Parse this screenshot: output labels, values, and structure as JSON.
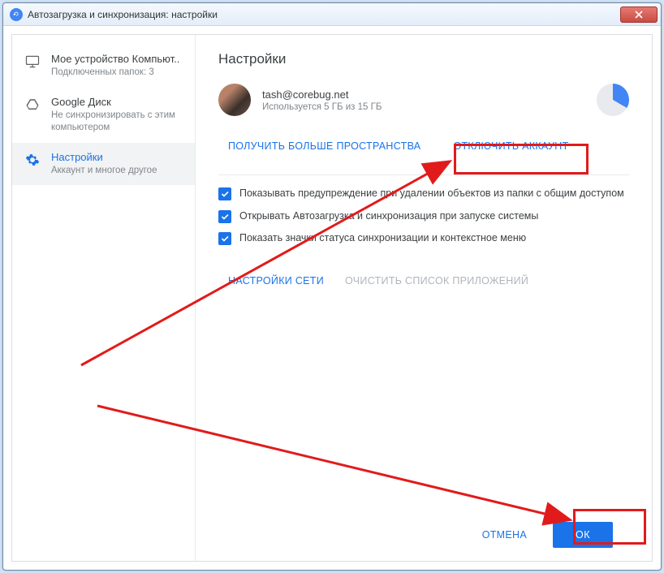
{
  "window": {
    "title": "Автозагрузка и синхронизация: настройки"
  },
  "sidebar": {
    "items": [
      {
        "title": "Мое устройство Компьют..",
        "sub": "Подключенных папок: 3"
      },
      {
        "title": "Google Диск",
        "sub": "Не синхронизировать с этим компьютером"
      },
      {
        "title": "Настройки",
        "sub": "Аккаунт и многое другое"
      }
    ]
  },
  "main": {
    "heading": "Настройки",
    "account": {
      "email": "tash@corebug.net",
      "usage": "Используется 5 ГБ из 15 ГБ"
    },
    "links": {
      "more_space": "ПОЛУЧИТЬ БОЛЬШЕ ПРОСТРАНСТВА",
      "disconnect": "ОТКЛЮЧИТЬ АККАУНТ"
    },
    "checks": {
      "warn_delete": "Показывать предупреждение при удалении объектов из папки с общим доступом",
      "open_startup": "Открывать Автозагрузка и синхронизация при запуске системы",
      "show_icons": "Показать значки статуса синхронизации и контекстное меню"
    },
    "buttons": {
      "network": "НАСТРОЙКИ СЕТИ",
      "clear_apps": "ОЧИСТИТЬ СПИСОК ПРИЛОЖЕНИЙ"
    }
  },
  "footer": {
    "cancel": "ОТМЕНА",
    "ok": "ОК"
  },
  "colors": {
    "accent": "#1a73e8",
    "annotation": "#e11b1b"
  }
}
